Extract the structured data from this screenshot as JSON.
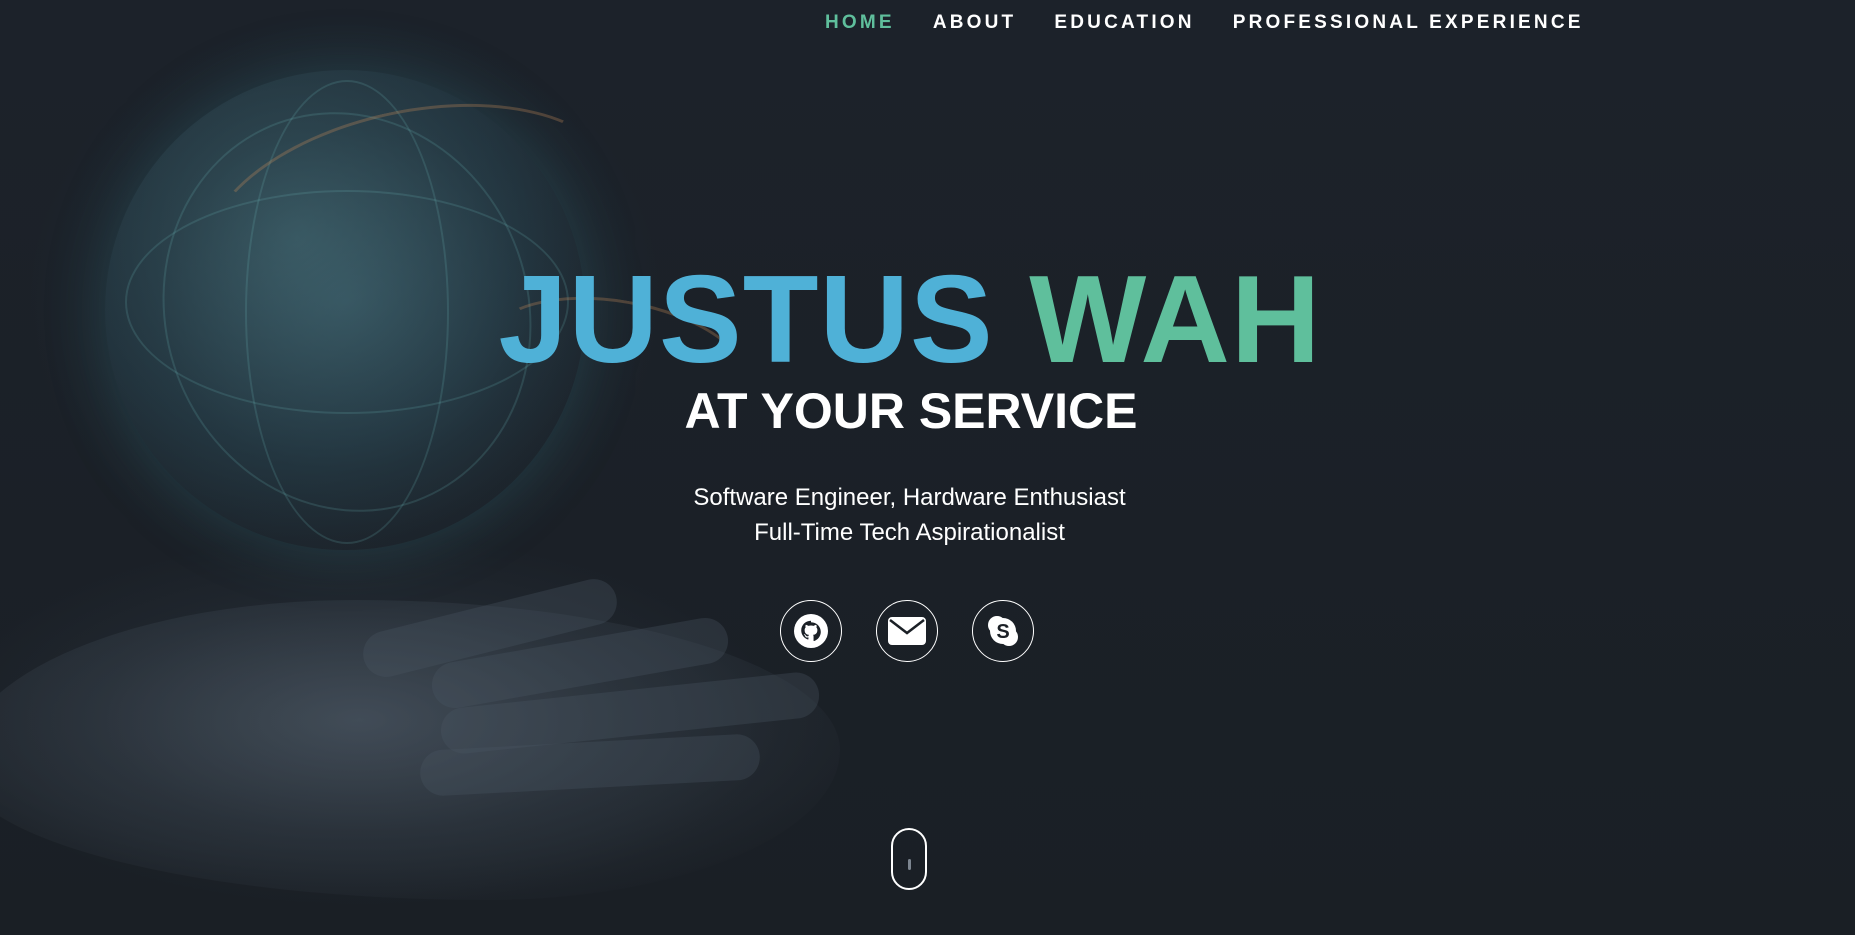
{
  "nav": {
    "items": [
      {
        "label": "HOME",
        "active": true
      },
      {
        "label": "ABOUT",
        "active": false
      },
      {
        "label": "EDUCATION",
        "active": false
      },
      {
        "label": "PROFESSIONAL EXPERIENCE",
        "active": false
      }
    ],
    "active_color": "#5fbf9c"
  },
  "hero": {
    "first_name": "JUSTUS",
    "last_name": "WAH",
    "tagline": "AT YOUR SERVICE",
    "subtitle_line1": "Software Engineer, Hardware Enthusiast",
    "subtitle_line2": "Full-Time Tech Aspirationalist",
    "first_name_color": "#4fb1d7",
    "last_name_color": "#5fbf9c"
  },
  "socials": [
    {
      "icon": "github-icon"
    },
    {
      "icon": "envelope-icon"
    },
    {
      "icon": "skype-icon"
    }
  ],
  "scroll_indicator": {
    "icon": "mouse-scroll-icon"
  },
  "background": {
    "image": "globe-in-hand"
  }
}
